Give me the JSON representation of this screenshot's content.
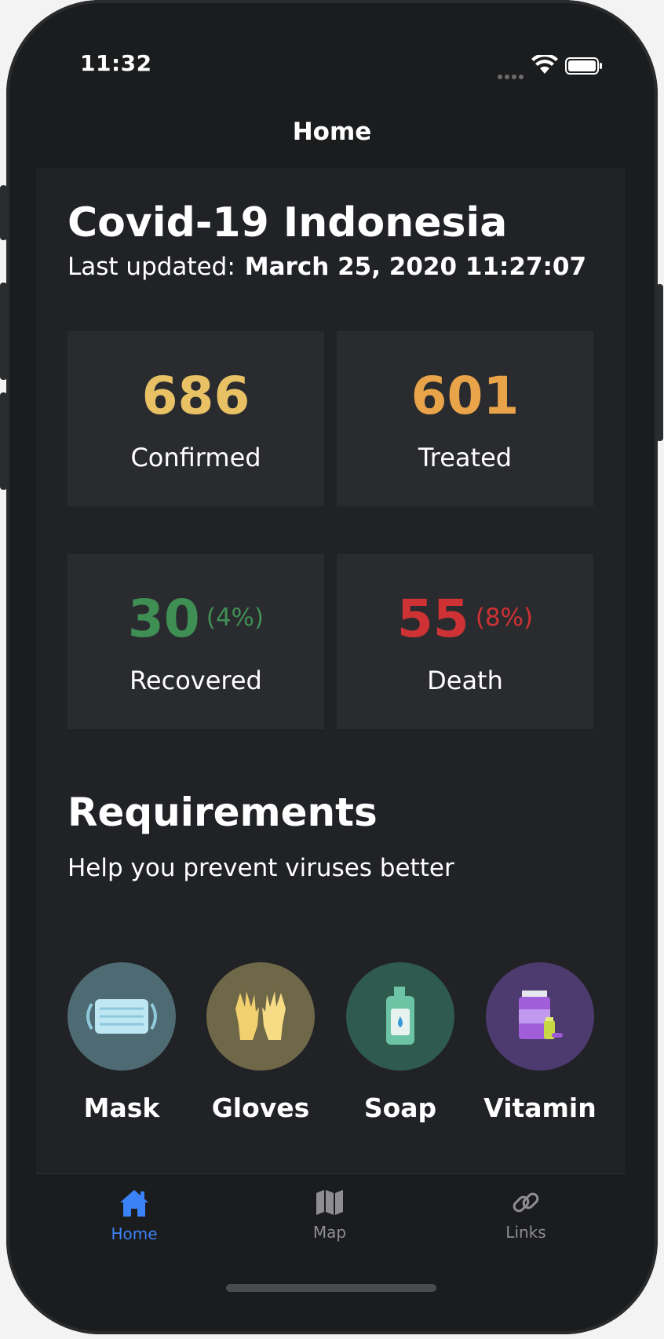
{
  "status": {
    "time": "11:32"
  },
  "nav": {
    "title": "Home"
  },
  "summary": {
    "title": "Covid-19 Indonesia",
    "updated_label": "Last updated:",
    "updated_value": "March 25, 2020 11:27:07"
  },
  "stats": {
    "confirmed": {
      "value": "686",
      "label": "Confirmed",
      "color": "#e8c165"
    },
    "treated": {
      "value": "601",
      "label": "Treated",
      "color": "#e9a44a"
    },
    "recovered": {
      "value": "30",
      "percent": "(4%)",
      "label": "Recovered",
      "color": "#3f8f55"
    },
    "death": {
      "value": "55",
      "percent": "(8%)",
      "label": "Death",
      "color": "#cf3234"
    }
  },
  "requirements": {
    "title": "Requirements",
    "subtitle": "Help you prevent viruses better",
    "items": [
      {
        "name": "Mask",
        "icon": "mask-icon",
        "bg": "#4e6a72"
      },
      {
        "name": "Gloves",
        "icon": "gloves-icon",
        "bg": "#6f6848"
      },
      {
        "name": "Soap",
        "icon": "soap-icon",
        "bg": "#2f5b4e"
      },
      {
        "name": "Vitamin",
        "icon": "vitamin-icon",
        "bg": "#4d3a6e"
      }
    ]
  },
  "tabs": [
    {
      "label": "Home",
      "icon": "home-icon",
      "active": true,
      "color": "#3b82f6"
    },
    {
      "label": "Map",
      "icon": "map-icon",
      "active": false,
      "color": "#8e8e92"
    },
    {
      "label": "Links",
      "icon": "link-icon",
      "active": false,
      "color": "#8e8e92"
    }
  ]
}
